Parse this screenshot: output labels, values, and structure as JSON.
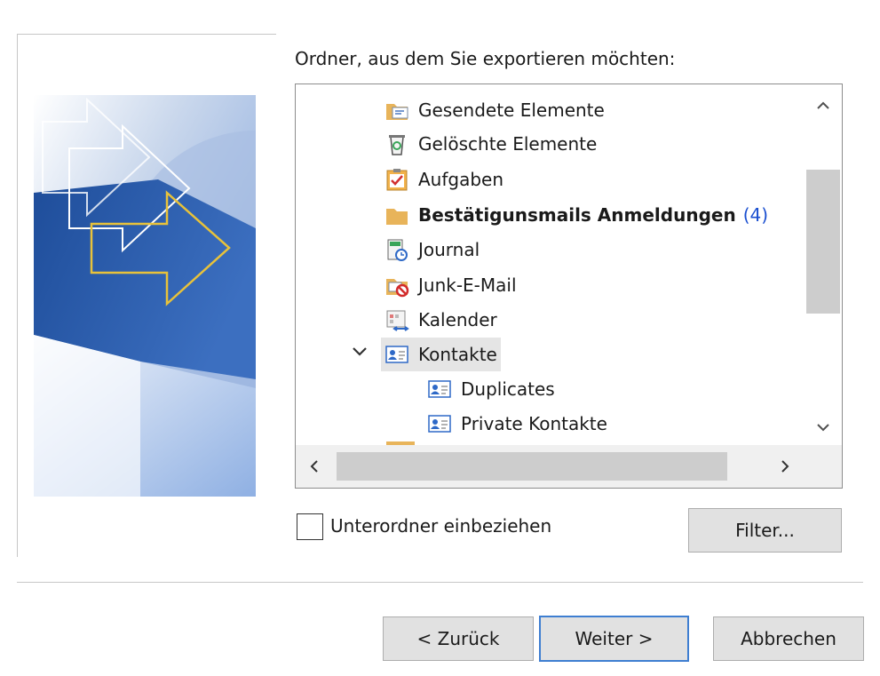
{
  "prompt": "Ordner, aus dem Sie exportieren möchten:",
  "folders": [
    {
      "label": "Gesendete Elemente",
      "icon": "sent-items-folder-icon"
    },
    {
      "label": "Gelöschte Elemente",
      "icon": "recycle-bin-icon"
    },
    {
      "label": "Aufgaben",
      "icon": "task-checkbox-icon"
    },
    {
      "label": "Bestätigunsmails Anmeldungen",
      "icon": "folder-icon",
      "unread": "(4)"
    },
    {
      "label": "Journal",
      "icon": "journal-icon"
    },
    {
      "label": "Junk-E-Mail",
      "icon": "junk-mail-icon"
    },
    {
      "label": "Kalender",
      "icon": "calendar-icon"
    },
    {
      "label": "Kontakte",
      "icon": "contact-card-icon"
    },
    {
      "label": "Duplicates",
      "icon": "contact-card-icon"
    },
    {
      "label": "Private Kontakte",
      "icon": "contact-card-icon"
    }
  ],
  "include_subfolders": {
    "label": "Unterordner einbeziehen",
    "checked": false
  },
  "buttons": {
    "filter": "Filter...",
    "back": "< Zurück",
    "next": "Weiter >",
    "cancel": "Abbrechen"
  },
  "colors": {
    "folder": "#e8b45a",
    "selected_row": "#e5e5e5",
    "unread_count": "#1a4fd0",
    "default_button_border": "#3e7ed1"
  }
}
